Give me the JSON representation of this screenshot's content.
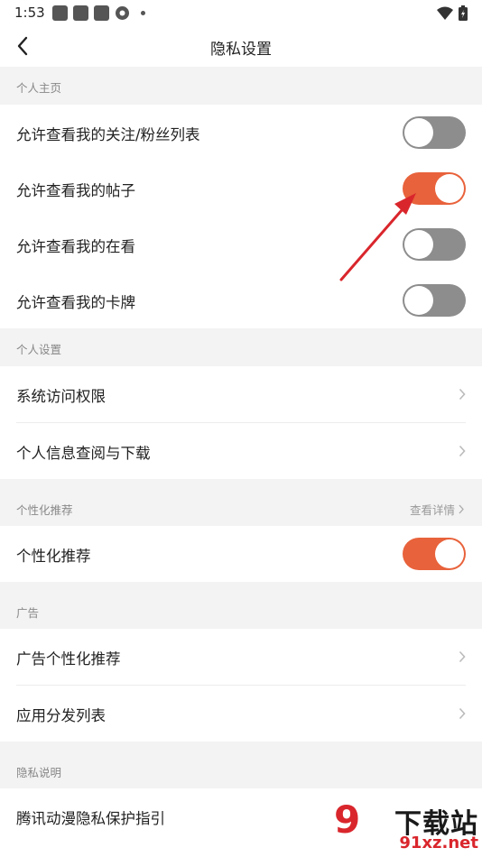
{
  "status_bar": {
    "time": "1:53"
  },
  "nav": {
    "title": "隐私设置"
  },
  "sections": {
    "personal_home": {
      "header": "个人主页",
      "items": [
        {
          "label": "允许查看我的关注/粉丝列表",
          "toggle": "off"
        },
        {
          "label": "允许查看我的帖子",
          "toggle": "on"
        },
        {
          "label": "允许查看我的在看",
          "toggle": "off"
        },
        {
          "label": "允许查看我的卡牌",
          "toggle": "off"
        }
      ]
    },
    "personal_settings": {
      "header": "个人设置",
      "items": [
        {
          "label": "系统访问权限"
        },
        {
          "label": "个人信息查阅与下载"
        }
      ]
    },
    "personalized": {
      "header": "个性化推荐",
      "detail": "查看详情",
      "items": [
        {
          "label": "个性化推荐",
          "toggle": "on"
        }
      ]
    },
    "ads": {
      "header": "广告",
      "items": [
        {
          "label": "广告个性化推荐"
        },
        {
          "label": "应用分发列表"
        }
      ]
    },
    "privacy_notes": {
      "header": "隐私说明",
      "items": [
        {
          "label": "腾讯动漫隐私保护指引"
        }
      ]
    }
  },
  "watermark": {
    "text": "下载站",
    "url": "91xz.net",
    "logo": "9"
  },
  "colors": {
    "toggle_on": "#e8623b",
    "toggle_off": "#8d8d8d",
    "section_bg": "#f3f3f3",
    "arrow": "#d9262c"
  }
}
